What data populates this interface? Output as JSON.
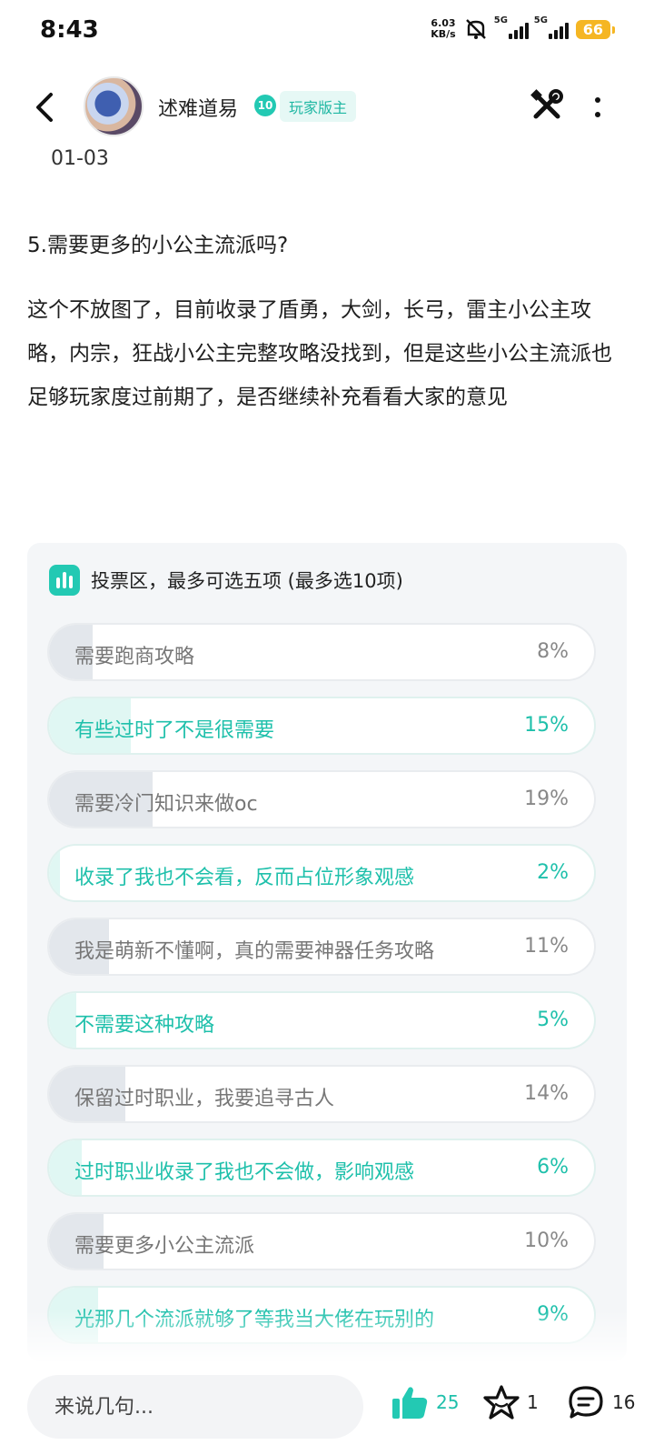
{
  "status_bar": {
    "time": "8:43",
    "net_speed_value": "6.03",
    "net_speed_unit": "KB/s",
    "signal1_label": "5G",
    "signal2_label": "5G",
    "battery": "66"
  },
  "header": {
    "username": "述难道易",
    "level": "10",
    "role_badge": "玩家版主",
    "date": "01-03"
  },
  "post": {
    "heading": "5.需要更多的小公主流派吗?",
    "body": "这个不放图了，目前收录了盾勇，大剑，长弓，雷主小公主攻略，内宗，狂战小公主完整攻略没找到，但是这些小公主流派也足够玩家度过前期了，是否继续补充看看大家的意见"
  },
  "vote": {
    "title": "投票区，最多可选五项 (最多选10项)",
    "accent_color": "#23c9b3",
    "options": [
      {
        "label": "需要跑商攻略",
        "percent": "8%",
        "share": 0.08,
        "selected": false
      },
      {
        "label": "有些过时了不是很需要",
        "percent": "15%",
        "share": 0.15,
        "selected": true
      },
      {
        "label": "需要冷门知识来做oc",
        "percent": "19%",
        "share": 0.19,
        "selected": false
      },
      {
        "label": "收录了我也不会看，反而占位形象观感",
        "percent": "2%",
        "share": 0.02,
        "selected": true
      },
      {
        "label": "我是萌新不懂啊，真的需要神器任务攻略",
        "percent": "11%",
        "share": 0.11,
        "selected": false
      },
      {
        "label": "不需要这种攻略",
        "percent": "5%",
        "share": 0.05,
        "selected": true
      },
      {
        "label": "保留过时职业，我要追寻古人",
        "percent": "14%",
        "share": 0.14,
        "selected": false
      },
      {
        "label": "过时职业收录了我也不会做，影响观感",
        "percent": "6%",
        "share": 0.06,
        "selected": true
      },
      {
        "label": "需要更多小公主流派",
        "percent": "10%",
        "share": 0.1,
        "selected": false
      },
      {
        "label": "光那几个流派就够了等我当大佬在玩别的",
        "percent": "9%",
        "share": 0.09,
        "selected": true
      }
    ]
  },
  "bottom_bar": {
    "comment_placeholder": "来说几句...",
    "like_count": "25",
    "favorite_count": "1",
    "comment_count": "16"
  },
  "icons": [
    "back-arrow-icon",
    "tools-icon",
    "more-vertical-icon",
    "vote-chart-icon",
    "thumbs-up-icon",
    "star-icon",
    "comment-icon"
  ]
}
